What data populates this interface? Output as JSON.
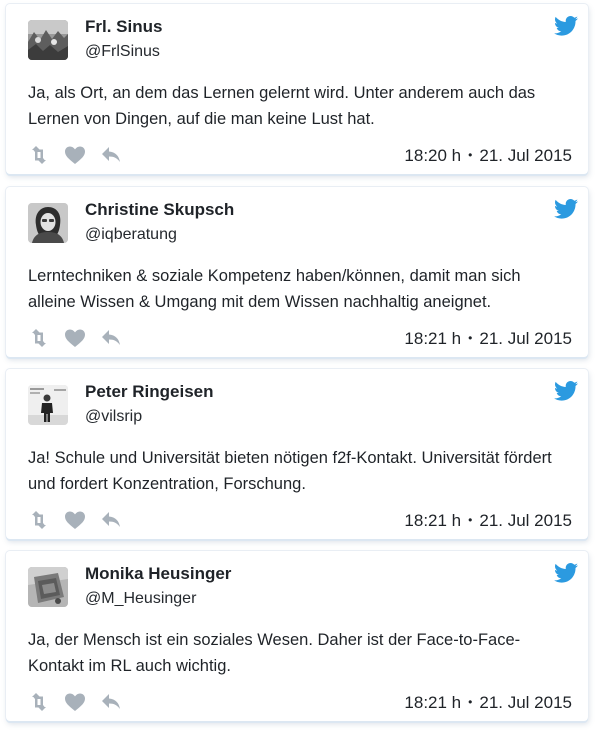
{
  "colors": {
    "twitter_blue": "#2b9ae0",
    "action_gray": "#a8b1ba",
    "text": "#1f2328"
  },
  "tweets": [
    {
      "name": "Frl. Sinus",
      "handle": "@FrlSinus",
      "text": "Ja, als Ort, an dem das Lernen gelernt wird. Unter anderem auch das Lernen von Dingen, auf die man keine Lust hat.",
      "time": "18:20 h",
      "separator": "•",
      "date": "21. Jul 2015",
      "avatar_icon": "avatar-crowd-photo"
    },
    {
      "name": "Christine Skupsch",
      "handle": "@iqberatung",
      "text": "Lerntechniken & soziale Kompetenz haben/können, damit man sich alleine Wissen & Umgang mit dem Wissen nachhaltig aneignet.",
      "time": "18:21 h",
      "separator": "•",
      "date": "21. Jul 2015",
      "avatar_icon": "avatar-portrait-photo"
    },
    {
      "name": "Peter Ringeisen",
      "handle": "@vilsrip",
      "text": "Ja! Schule und Universität bieten nötigen f2f-Kontakt. Universität fördert und fordert Konzentration, Forschung.",
      "time": "18:21 h",
      "separator": "•",
      "date": "21. Jul 2015",
      "avatar_icon": "avatar-figure-photo"
    },
    {
      "name": "Monika Heusinger",
      "handle": "@M_Heusinger",
      "text": "Ja, der Mensch ist ein soziales Wesen. Daher ist der Face-to-Face-Kontakt im RL auch wichtig.",
      "time": "18:21 h",
      "separator": "•",
      "date": "21. Jul 2015",
      "avatar_icon": "avatar-object-photo"
    }
  ]
}
